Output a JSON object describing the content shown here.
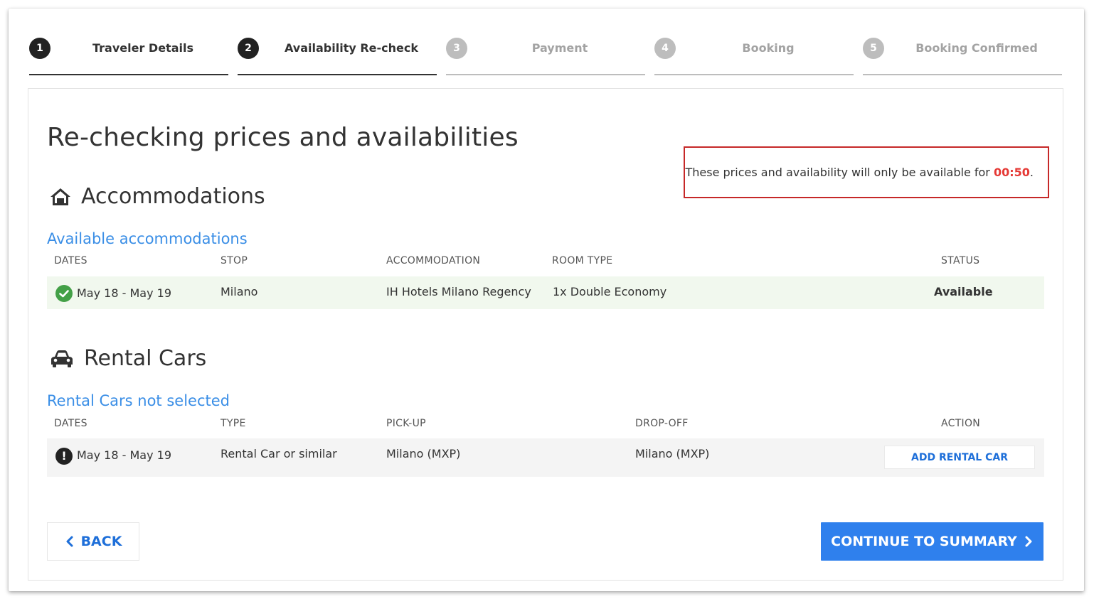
{
  "stepper": [
    {
      "num": "1",
      "label": "Traveler Details",
      "state": "active"
    },
    {
      "num": "2",
      "label": "Availability Re-check",
      "state": "active"
    },
    {
      "num": "3",
      "label": "Payment",
      "state": "inactive"
    },
    {
      "num": "4",
      "label": "Booking",
      "state": "inactive"
    },
    {
      "num": "5",
      "label": "Booking Confirmed",
      "state": "inactive"
    }
  ],
  "page_title": "Re-checking prices and availabilities",
  "timer": {
    "prefix": "These prices and availability will only be available for ",
    "time": "00:50",
    "suffix": "."
  },
  "accommodations": {
    "title": "Accommodations",
    "icon": "home-icon",
    "subtitle": "Available accommodations",
    "headers": {
      "dates": "DATES",
      "stop": "STOP",
      "accommodation": "ACCOMMODATION",
      "room_type": "ROOM TYPE",
      "status": "STATUS"
    },
    "rows": [
      {
        "dates": "May 18 - May 19",
        "stop": "Milano",
        "accommodation": "IH Hotels Milano Regency",
        "room_type": "1x Double Economy",
        "status": "Available",
        "status_icon": "check-circle-icon"
      }
    ]
  },
  "rental_cars": {
    "title": "Rental Cars",
    "icon": "car-icon",
    "subtitle": "Rental Cars not selected",
    "headers": {
      "dates": "DATES",
      "type": "TYPE",
      "pickup": "PICK-UP",
      "dropoff": "DROP-OFF",
      "action": "ACTION"
    },
    "rows": [
      {
        "dates": "May 18 - May 19",
        "type": "Rental Car or similar",
        "pickup": "Milano (MXP)",
        "dropoff": "Milano (MXP)",
        "action": "ADD RENTAL CAR",
        "status_icon": "exclamation-circle-icon"
      }
    ]
  },
  "buttons": {
    "back": "BACK",
    "continue": "CONTINUE TO SUMMARY"
  },
  "colors": {
    "accent": "#2f80ed",
    "link": "#3a8ee6",
    "timer_border": "#c62828",
    "timer_time": "#e53935",
    "available_row": "#f1f8ee",
    "check_icon": "#43a047"
  }
}
